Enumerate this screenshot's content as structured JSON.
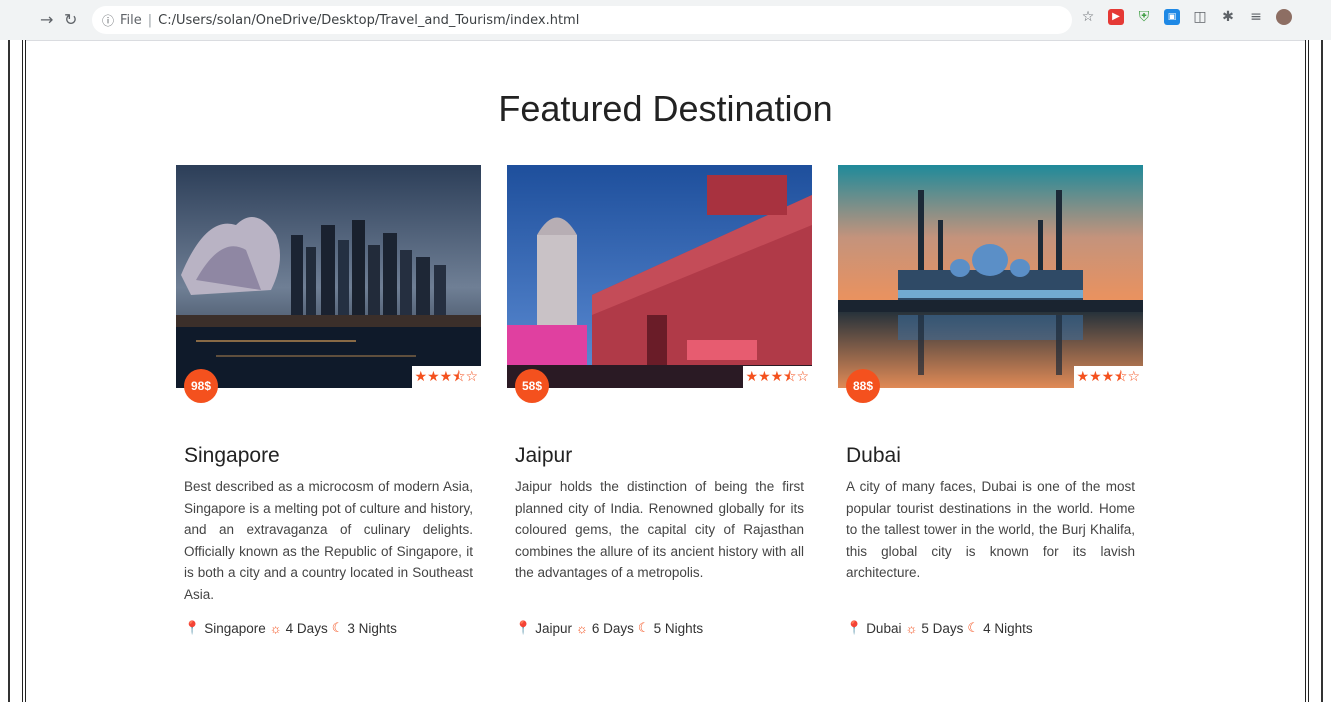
{
  "browser": {
    "address_label": "File",
    "url": "C:/Users/solan/OneDrive/Desktop/Travel_and_Tourism/index.html"
  },
  "page": {
    "title": "Featured Destination"
  },
  "colors": {
    "accent": "#f4511e"
  },
  "cards": [
    {
      "name": "Singapore",
      "price": "98$",
      "rating": 3.5,
      "rating_max": 5,
      "description": "Best described as a microcosm of modern Asia, Singapore is a melting pot of culture and history, and an extravaganza of culinary delights. Officially known as the Republic of Singapore, it is both a city and a country located in Southeast Asia.",
      "location": "Singapore",
      "days": "4 Days",
      "nights": "3 Nights"
    },
    {
      "name": "Jaipur",
      "price": "58$",
      "rating": 3.5,
      "rating_max": 5,
      "description": "Jaipur holds the distinction of being the first planned city of India. Renowned globally for its coloured gems, the capital city of Rajasthan combines the allure of its ancient history with all the advantages of a metropolis.",
      "location": "Jaipur",
      "days": "6 Days",
      "nights": "5 Nights"
    },
    {
      "name": "Dubai",
      "price": "88$",
      "rating": 3.5,
      "rating_max": 5,
      "description": "A city of many faces, Dubai is one of the most popular tourist destinations in the world. Home to the tallest tower in the world, the Burj Khalifa, this global city is known for its lavish architecture.",
      "location": "Dubai",
      "days": "5 Days",
      "nights": "4 Nights"
    }
  ]
}
